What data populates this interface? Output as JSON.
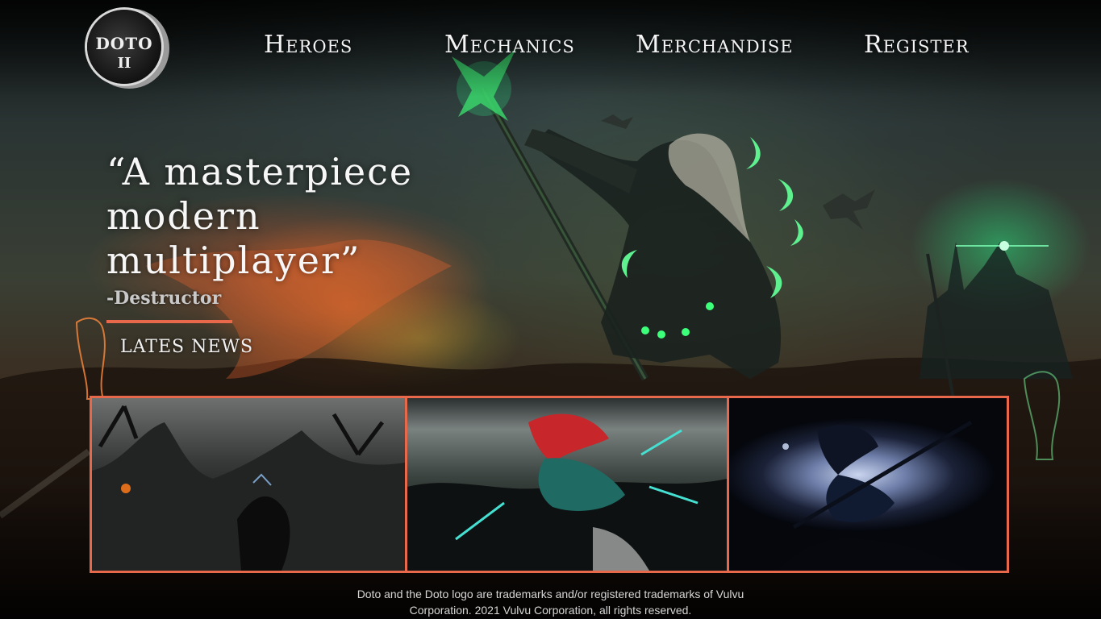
{
  "logo": {
    "line1": "DOTO",
    "line2": "II"
  },
  "nav": {
    "items": [
      {
        "label": "Heroes"
      },
      {
        "label": "Mechanics"
      },
      {
        "label": "Merchandise"
      },
      {
        "label": "Register"
      }
    ]
  },
  "hero": {
    "quote_lines": [
      "“A masterpiece",
      "modern",
      "multiplayer”"
    ],
    "author": "-Destructor",
    "news_link": "Lates news"
  },
  "news": {
    "cards": [
      {
        "theme": "dark misty ruins"
      },
      {
        "theme": "red-haired hero in teal armor"
      },
      {
        "theme": "blue archer silhouette"
      }
    ]
  },
  "footer": {
    "legal_line1": "Doto and the Doto logo are trademarks and/or registered trademarks of Vulvu",
    "legal_line2": "Corporation. 2021 Vulvu Corporation, all rights reserved."
  },
  "colors": {
    "accent": "#e8684c",
    "text": "#f2f2f2",
    "glow_green": "#2cff8c"
  }
}
